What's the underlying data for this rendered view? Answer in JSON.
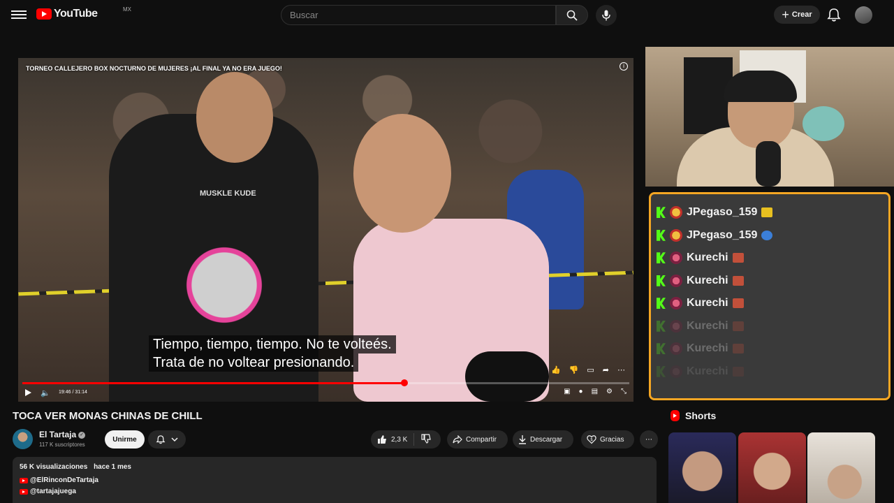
{
  "header": {
    "logo_text": "YouTube",
    "country": "MX",
    "search_placeholder": "Buscar",
    "create_label": "Crear"
  },
  "video": {
    "overlay_title": "TORNEO CALLEJERO BOX NOCTURNO DE MUJERES ¡AL FINAL YA NO ERA JUEGO!",
    "shirt_text": "MUSKLE KUDE",
    "subtitle_line1": "Tiempo, tiempo, tiempo. No te volteés.",
    "subtitle_line2": "Trata de no voltear presionando.",
    "time": "19:46 / 31:14",
    "progress": 0.63
  },
  "title": "TOCA VER MONAS CHINAS DE CHILL",
  "channel": {
    "name": "El Tartaja",
    "subscribers": "117 K suscriptores",
    "subscribe_label": "Unirme"
  },
  "actions": {
    "likes": "2,3 K",
    "share": "Compartir",
    "download": "Descargar",
    "thanks": "Gracias"
  },
  "description": {
    "views": "56 K visualizaciones",
    "date": "hace 1 mes",
    "links": [
      "@ElRinconDeTartaja",
      "@tartajajuega"
    ]
  },
  "chat": {
    "messages": [
      {
        "user": "JPegaso_159"
      },
      {
        "user": "JPegaso_159"
      },
      {
        "user": "Kurechi"
      },
      {
        "user": "Kurechi"
      },
      {
        "user": "Kurechi"
      },
      {
        "user": "Kurechi"
      },
      {
        "user": "Kurechi"
      },
      {
        "user": "Kurechi"
      }
    ],
    "colors": {
      "border": "#f5a623",
      "kick": "#53fc18"
    }
  },
  "shorts": {
    "title": "Shorts"
  }
}
